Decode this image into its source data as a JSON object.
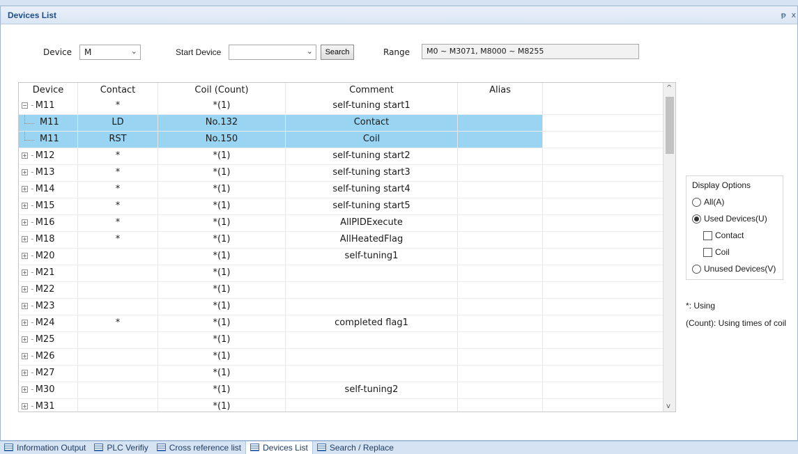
{
  "panel": {
    "title": "Devices List",
    "pin_glyph": "ᵽ",
    "close_glyph": "x"
  },
  "toolbar": {
    "device_label": "Device",
    "device_value": "M",
    "start_label": "Start Device",
    "start_value": "",
    "search_label": "Search",
    "range_label": "Range",
    "range_value": "M0 ~ M3071,  M8000 ~ M8255"
  },
  "grid": {
    "columns": [
      "Device",
      "Contact",
      "Coil (Count)",
      "Comment",
      "Alias"
    ],
    "rows": [
      {
        "type": "parent",
        "toggle": "−",
        "device": "M11",
        "contact": "*",
        "coil": "*(1)",
        "comment": "self-tuning start1",
        "alias": ""
      },
      {
        "type": "child",
        "device": "M11",
        "contact": "LD",
        "coil": "No.132",
        "comment": "Contact",
        "alias": ""
      },
      {
        "type": "child",
        "device": "M11",
        "contact": "RST",
        "coil": "No.150",
        "comment": "Coil",
        "alias": ""
      },
      {
        "type": "parent",
        "toggle": "+",
        "device": "M12",
        "contact": "*",
        "coil": "*(1)",
        "comment": "self-tuning start2",
        "alias": ""
      },
      {
        "type": "parent",
        "toggle": "+",
        "device": "M13",
        "contact": "*",
        "coil": "*(1)",
        "comment": "self-tuning start3",
        "alias": ""
      },
      {
        "type": "parent",
        "toggle": "+",
        "device": "M14",
        "contact": "*",
        "coil": "*(1)",
        "comment": "self-tuning start4",
        "alias": ""
      },
      {
        "type": "parent",
        "toggle": "+",
        "device": "M15",
        "contact": "*",
        "coil": "*(1)",
        "comment": "self-tuning start5",
        "alias": ""
      },
      {
        "type": "parent",
        "toggle": "+",
        "device": "M16",
        "contact": "*",
        "coil": "*(1)",
        "comment": "AllPIDExecute",
        "alias": ""
      },
      {
        "type": "parent",
        "toggle": "+",
        "device": "M18",
        "contact": "*",
        "coil": "*(1)",
        "comment": "AllHeatedFlag",
        "alias": ""
      },
      {
        "type": "parent",
        "toggle": "+",
        "device": "M20",
        "contact": "",
        "coil": "*(1)",
        "comment": "self-tuning1",
        "alias": ""
      },
      {
        "type": "parent",
        "toggle": "+",
        "device": "M21",
        "contact": "",
        "coil": "*(1)",
        "comment": "",
        "alias": ""
      },
      {
        "type": "parent",
        "toggle": "+",
        "device": "M22",
        "contact": "",
        "coil": "*(1)",
        "comment": "",
        "alias": ""
      },
      {
        "type": "parent",
        "toggle": "+",
        "device": "M23",
        "contact": "",
        "coil": "*(1)",
        "comment": "",
        "alias": ""
      },
      {
        "type": "parent",
        "toggle": "+",
        "device": "M24",
        "contact": "*",
        "coil": "*(1)",
        "comment": "completed flag1",
        "alias": ""
      },
      {
        "type": "parent",
        "toggle": "+",
        "device": "M25",
        "contact": "",
        "coil": "*(1)",
        "comment": "",
        "alias": ""
      },
      {
        "type": "parent",
        "toggle": "+",
        "device": "M26",
        "contact": "",
        "coil": "*(1)",
        "comment": "",
        "alias": ""
      },
      {
        "type": "parent",
        "toggle": "+",
        "device": "M27",
        "contact": "",
        "coil": "*(1)",
        "comment": "",
        "alias": ""
      },
      {
        "type": "parent",
        "toggle": "+",
        "device": "M30",
        "contact": "",
        "coil": "*(1)",
        "comment": "self-tuning2",
        "alias": ""
      },
      {
        "type": "parent",
        "toggle": "+",
        "device": "M31",
        "contact": "",
        "coil": "*(1)",
        "comment": "",
        "alias": ""
      }
    ],
    "scroll_up_glyph": "^",
    "scroll_down_glyph": "v"
  },
  "display_options": {
    "title": "Display Options",
    "all": "All(A)",
    "used": "Used Devices(U)",
    "contact": "Contact",
    "coil": "Coil",
    "unused": "Unused Devices(V)",
    "selected": "used"
  },
  "legend": {
    "using": "*: Using",
    "count": "(Count): Using times of coil"
  },
  "bottom_tabs": [
    {
      "label": "Information Output",
      "active": false
    },
    {
      "label": "PLC Verifiy",
      "active": false
    },
    {
      "label": "Cross reference list",
      "active": false
    },
    {
      "label": "Devices List",
      "active": true
    },
    {
      "label": "Search / Replace",
      "active": false
    }
  ],
  "colors": {
    "selected_row": "#99d5f3",
    "title_text": "#1d4d86",
    "frame": "#d6e3f2"
  }
}
